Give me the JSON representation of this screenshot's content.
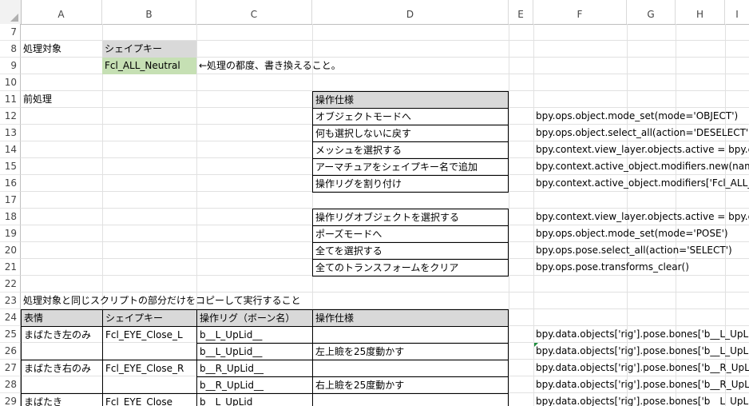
{
  "columns": [
    "A",
    "B",
    "C",
    "D",
    "E",
    "F",
    "G",
    "H",
    "I"
  ],
  "rows": [
    "7",
    "8",
    "9",
    "10",
    "11",
    "12",
    "13",
    "14",
    "15",
    "16",
    "17",
    "18",
    "19",
    "20",
    "21",
    "22",
    "23",
    "24",
    "25",
    "26",
    "27",
    "28",
    "29"
  ],
  "cells": {
    "A8": "処理対象",
    "B8": "シェイプキー",
    "B9": "Fcl_ALL_Neutral",
    "C9": "←処理の都度、書き換えること。",
    "A11": "前処理",
    "D11": "操作仕様",
    "D12": "オブジェクトモードへ",
    "D13": "何も選択しないに戻す",
    "D14": "メッシュを選択する",
    "D15": "アーマチュアをシェイプキー名で追加",
    "D16": "操作リグを割り付け",
    "D18": "操作リグオブジェクトを選択する",
    "D19": "ポーズモードへ",
    "D20": "全てを選択する",
    "D21": "全てのトランスフォームをクリア",
    "F12": "bpy.ops.object.mode_set(mode='OBJECT')",
    "F13": "bpy.ops.object.select_all(action='DESELECT')",
    "F14": "bpy.context.view_layer.objects.active = bpy.cont",
    "F15": "bpy.context.active_object.modifiers.new(name=",
    "F16": "bpy.context.active_object.modifiers['Fcl_ALL_Ne",
    "F18": "bpy.context.view_layer.objects.active = bpy.cont",
    "F19": "bpy.ops.object.mode_set(mode='POSE')",
    "F20": "bpy.ops.pose.select_all(action='SELECT')",
    "F21": "bpy.ops.pose.transforms_clear()",
    "A23": "処理対象と同じスクリプトの部分だけをコピーして実行すること",
    "A24": "表情",
    "B24": "シェイプキー",
    "C24": "操作リグ（ボーン名）",
    "D24": "操作仕様",
    "A25": "まばたき左のみ",
    "B25": "Fcl_EYE_Close_L",
    "C25": "b__L_UpLid__",
    "F25": "bpy.data.objects['rig'].pose.bones['b__L_UpLid_",
    "C26": "b__L_UpLid__",
    "D26": "左上瞼を25度動かす",
    "F26": "bpy.data.objects['rig'].pose.bones['b__L_UpLid_",
    "A27": "まばたき右のみ",
    "B27": "Fcl_EYE_Close_R",
    "C27": "b__R_UpLid__",
    "F27": "bpy.data.objects['rig'].pose.bones['b__R_UpLid_",
    "C28": "b__R_UpLid__",
    "D28": "右上瞼を25度動かす",
    "F28": "bpy.data.objects['rig'].pose.bones['b__R_UpLid_",
    "A29": "まばたき",
    "B29": "Fcl_EYE_Close",
    "C29": "b__L_UpLid__",
    "F29": "bpy.data.objects['rig'].pose.bones['b__L_UpLid_"
  },
  "colors": {
    "header_fill": "#d9d9d9",
    "key_fill": "#c6e0b4",
    "grid": "#e1e1e1",
    "comment_marker": "#1e8e3e"
  }
}
